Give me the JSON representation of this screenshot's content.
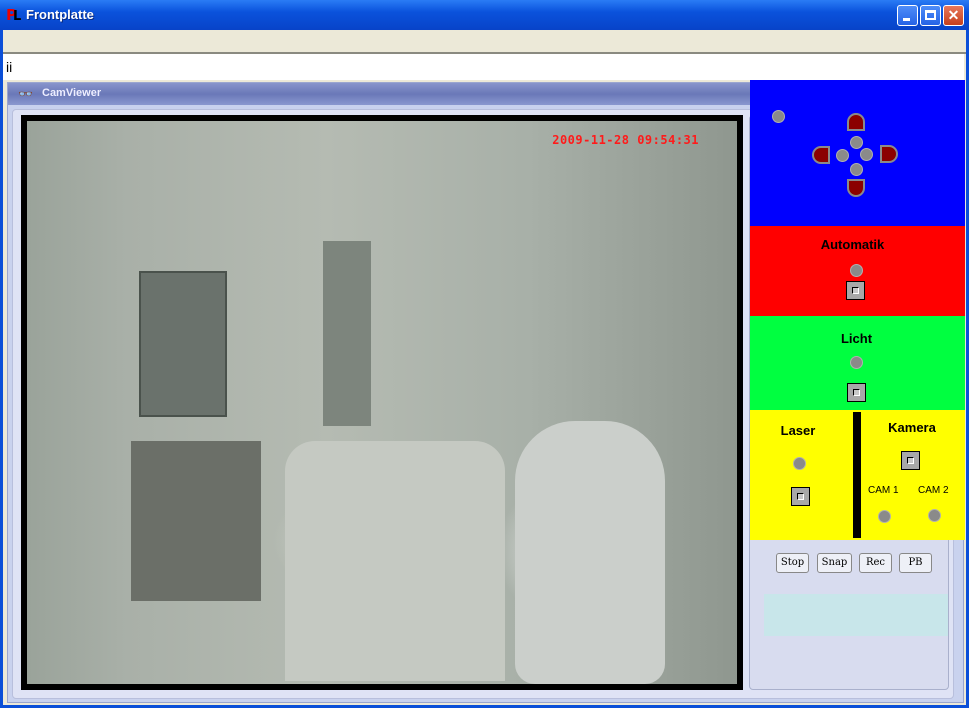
{
  "window": {
    "title": "Frontplatte",
    "app_icon": "pl-logo-icon",
    "controls": {
      "minimize": "minimize-icon",
      "maximize": "maximize-icon",
      "close": "close-icon"
    }
  },
  "text_field": {
    "value": "ii"
  },
  "camviewer": {
    "title": "CamViewer",
    "icon": "binoculars-icon",
    "timestamp": "2009-11-28 09:54:31",
    "buttons": [
      {
        "label": "Stop"
      },
      {
        "label": "Snap"
      },
      {
        "label": "Rec"
      },
      {
        "label": "PB"
      }
    ]
  },
  "control_panel": {
    "pan_tilt": {
      "colors": {
        "background": "#0000ff",
        "arrow": "#8b0000",
        "led": "#8a8a8a"
      }
    },
    "automatik": {
      "label": "Automatik",
      "color": "#ff0000"
    },
    "licht": {
      "label": "Licht",
      "color": "#00ff40"
    },
    "laser": {
      "label": "Laser",
      "color": "#ffff00"
    },
    "kamera": {
      "label": "Kamera",
      "cam1": "CAM 1",
      "cam2": "CAM 2"
    }
  }
}
